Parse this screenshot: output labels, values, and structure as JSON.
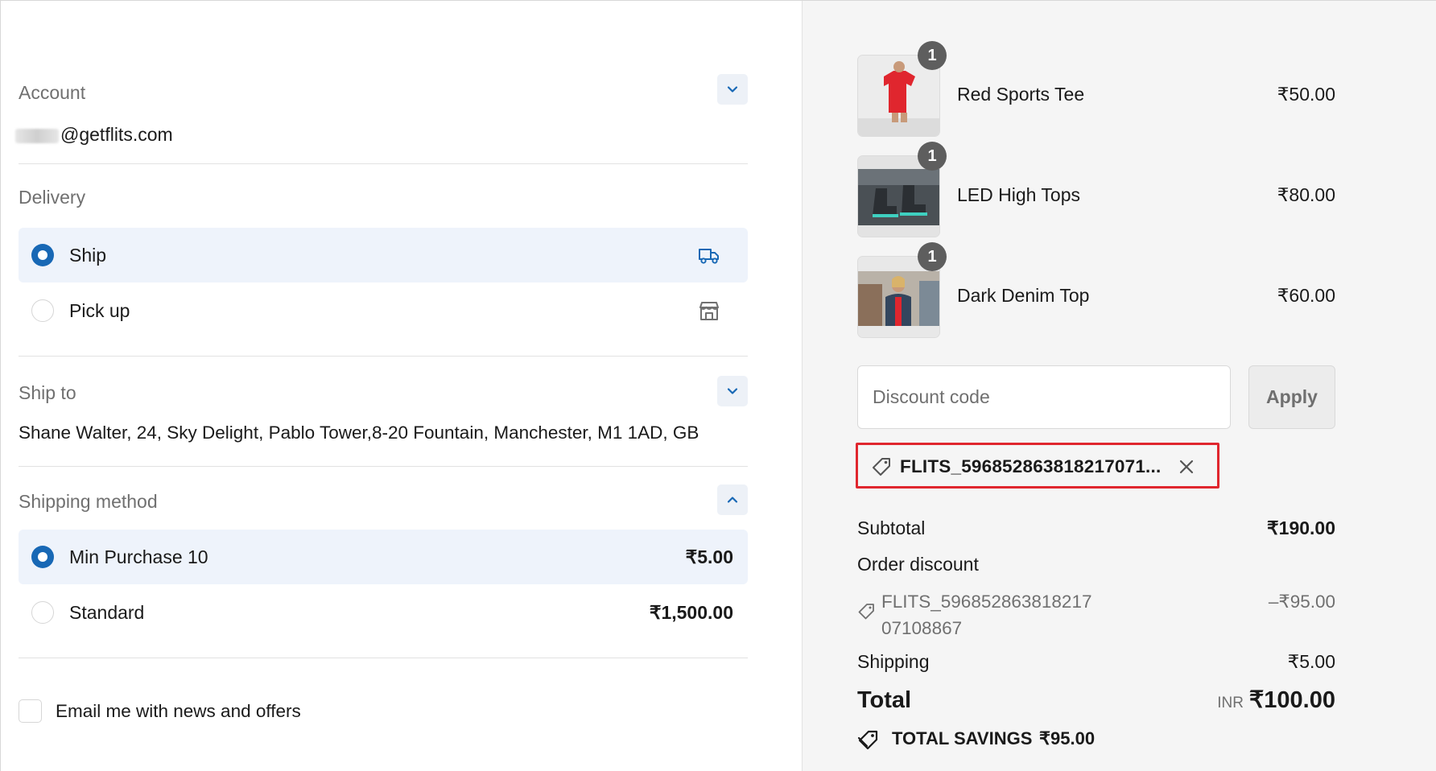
{
  "account": {
    "label": "Account",
    "email": "@getflits.com"
  },
  "delivery": {
    "label": "Delivery",
    "options": [
      {
        "label": "Ship",
        "icon": "truck-icon",
        "selected": true
      },
      {
        "label": "Pick up",
        "icon": "store-icon",
        "selected": false
      }
    ]
  },
  "ship_to": {
    "label": "Ship to",
    "address": "Shane Walter, 24, Sky Delight, Pablo Tower,8-20 Fountain, Manchester, M1 1AD, GB"
  },
  "shipping_method": {
    "label": "Shipping method",
    "options": [
      {
        "label": "Min Purchase 10",
        "price": "₹5.00",
        "selected": true
      },
      {
        "label": "Standard",
        "price": "₹1,500.00",
        "selected": false
      }
    ]
  },
  "newsletter": {
    "label": "Email me with news and offers",
    "checked": false
  },
  "cart": {
    "items": [
      {
        "name": "Red Sports Tee",
        "price": "₹50.00",
        "quantity": "1"
      },
      {
        "name": "LED High Tops",
        "price": "₹80.00",
        "quantity": "1"
      },
      {
        "name": "Dark Denim Top",
        "price": "₹60.00",
        "quantity": "1"
      }
    ]
  },
  "discount": {
    "placeholder": "Discount code",
    "apply_label": "Apply",
    "applied_code": "FLITS_596852863818217071..."
  },
  "summary": {
    "subtotal_label": "Subtotal",
    "subtotal_value": "₹190.00",
    "order_discount_label": "Order discount",
    "order_discount_code": "FLITS_59685286381821707108867",
    "order_discount_value": "–₹95.00",
    "shipping_label": "Shipping",
    "shipping_value": "₹5.00",
    "total_label": "Total",
    "currency": "INR",
    "total_value": "₹100.00",
    "savings_label": "TOTAL SAVINGS",
    "savings_value": "₹95.00"
  },
  "colors": {
    "accent": "#1868b5",
    "selected_bg": "#eef3fb",
    "highlight_border": "#e0262e",
    "summary_bg": "#f5f5f5"
  }
}
